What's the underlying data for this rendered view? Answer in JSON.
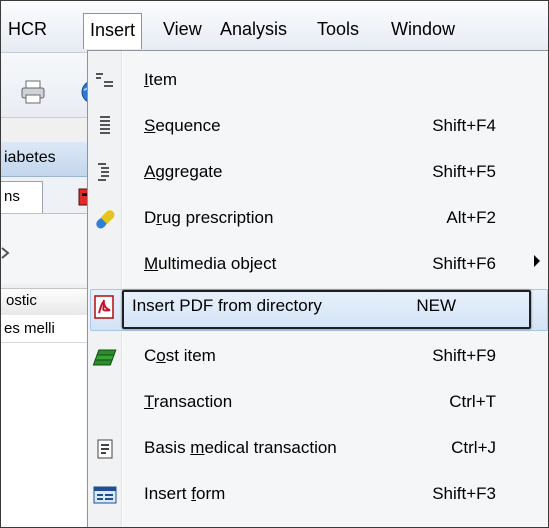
{
  "menubar": {
    "items": [
      {
        "label": "HCR"
      },
      {
        "label": "Insert"
      },
      {
        "label": "View"
      },
      {
        "label": "Analysis"
      },
      {
        "label": "Tools"
      },
      {
        "label": "Window"
      }
    ]
  },
  "background": {
    "title_fragment": "iabetes",
    "tab_fragment": "ns",
    "column_header_fragment": "ostic",
    "row_fragment": "es melli"
  },
  "insert_menu": {
    "items": [
      {
        "label": "Item",
        "mnemonic": "I",
        "shortcut": "",
        "icon": "item-list-icon"
      },
      {
        "label": "Sequence",
        "mnemonic": "S",
        "shortcut": "Shift+F4",
        "icon": "sequence-icon"
      },
      {
        "label": "Aggregate",
        "mnemonic": "A",
        "shortcut": "Shift+F5",
        "icon": "aggregate-icon"
      },
      {
        "label": "Drug prescription",
        "mnemonic": "r",
        "shortcut": "Alt+F2",
        "icon": "pill-icon"
      },
      {
        "label": "Multimedia object",
        "mnemonic": "M",
        "shortcut": "Shift+F6",
        "icon": "",
        "submenu": true
      },
      {
        "label": "Insert PDF from directory",
        "mnemonic": "",
        "shortcut": "NEW",
        "icon": "pdf-icon",
        "highlighted": true
      },
      {
        "label": "Cost item",
        "mnemonic": "o",
        "shortcut": "Shift+F9",
        "icon": "money-icon"
      },
      {
        "label": "Transaction",
        "mnemonic": "T",
        "shortcut": "Ctrl+T",
        "icon": ""
      },
      {
        "label": "Basis medical transaction",
        "mnemonic": "m",
        "shortcut": "Ctrl+J",
        "icon": "document-icon"
      },
      {
        "label": "Insert form",
        "mnemonic": "f",
        "shortcut": "Shift+F3",
        "icon": "form-icon"
      }
    ]
  },
  "colors": {
    "menubar_top": "#fbfcfe",
    "menu_background": "#f5f6f7",
    "highlight": "#d3e3f6",
    "callout_border": "#1b1e22"
  }
}
